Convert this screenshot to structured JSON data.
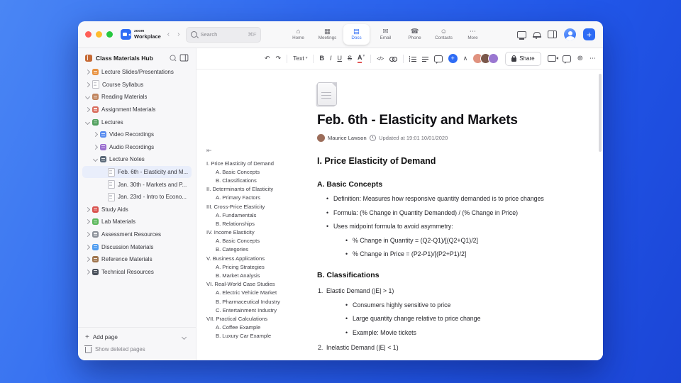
{
  "colors": {
    "accent": "#2e6cf5"
  },
  "icons": {
    "back": "‹",
    "forward": "›",
    "undo": "↶",
    "redo": "↷",
    "dropdown": "▾",
    "code": "</>",
    "collapse": "∧",
    "plus": "+",
    "more": "⋯",
    "globe": "⊕",
    "outline_collapse": "⇤"
  },
  "titlebar": {
    "logo_top": "zoom",
    "logo_bottom": "Workplace",
    "search": {
      "placeholder": "Search",
      "shortcut": "⌘F"
    },
    "tabs": [
      {
        "label": "Home",
        "glyph": "⌂"
      },
      {
        "label": "Meetings",
        "glyph": "▦"
      },
      {
        "label": "Docs",
        "glyph": "▤",
        "active": true
      },
      {
        "label": "Email",
        "glyph": "✉"
      },
      {
        "label": "Phone",
        "glyph": "☎"
      },
      {
        "label": "Contacts",
        "glyph": "☺"
      },
      {
        "label": "More",
        "glyph": "⋯"
      }
    ]
  },
  "sidebar": {
    "title": "Class Materials Hub",
    "add_page": "Add page",
    "show_deleted": "Show deleted pages",
    "items": [
      {
        "label": "Lecture Slides/Presentations",
        "indent": 0,
        "has_chevron": true,
        "icon": {
          "kind": "sq",
          "color": "#e8913f"
        }
      },
      {
        "label": "Course Syllabus",
        "indent": 0,
        "has_chevron": true,
        "icon": {
          "kind": "doc"
        }
      },
      {
        "label": "Reading Materials",
        "indent": 0,
        "has_chevron": true,
        "expanded": true,
        "icon": {
          "kind": "sq",
          "color": "#c0845e"
        }
      },
      {
        "label": "Assignment Materials",
        "indent": 0,
        "has_chevron": true,
        "icon": {
          "kind": "sq",
          "color": "#d96c5c"
        }
      },
      {
        "label": "Lectures",
        "indent": 0,
        "has_chevron": true,
        "expanded": true,
        "icon": {
          "kind": "sq",
          "color": "#51a05e"
        }
      },
      {
        "label": "Video Recordings",
        "indent": 1,
        "has_chevron": true,
        "icon": {
          "kind": "sq",
          "color": "#5b8def"
        }
      },
      {
        "label": "Audio Recordings",
        "indent": 1,
        "has_chevron": true,
        "icon": {
          "kind": "sq",
          "color": "#9b6fd0"
        }
      },
      {
        "label": "Lecture Notes",
        "indent": 1,
        "has_chevron": true,
        "expanded": true,
        "icon": {
          "kind": "sq",
          "color": "#5d6b7a"
        }
      },
      {
        "label": "Feb. 6th - Elasticity and M...",
        "indent": 2,
        "has_chevron": false,
        "selected": true,
        "icon": {
          "kind": "doc"
        }
      },
      {
        "label": "Jan. 30th - Markets and P...",
        "indent": 2,
        "has_chevron": false,
        "icon": {
          "kind": "doc"
        }
      },
      {
        "label": "Jan. 23rd - Intro to Econo...",
        "indent": 2,
        "has_chevron": false,
        "icon": {
          "kind": "doc"
        }
      },
      {
        "label": "Study Aids",
        "indent": 0,
        "has_chevron": true,
        "icon": {
          "kind": "sq",
          "color": "#d9534f"
        }
      },
      {
        "label": "Lab Materials",
        "indent": 0,
        "has_chevron": true,
        "icon": {
          "kind": "sq",
          "color": "#5cb85c"
        }
      },
      {
        "label": "Assessment Resources",
        "indent": 0,
        "has_chevron": true,
        "icon": {
          "kind": "sq",
          "color": "#8a8f98"
        }
      },
      {
        "label": "Discussion Materials",
        "indent": 0,
        "has_chevron": true,
        "icon": {
          "kind": "sq",
          "color": "#4f9cf0"
        }
      },
      {
        "label": "Reference Materials",
        "indent": 0,
        "has_chevron": true,
        "icon": {
          "kind": "sq",
          "color": "#a0764f"
        }
      },
      {
        "label": "Technical Resources",
        "indent": 0,
        "has_chevron": true,
        "icon": {
          "kind": "sq",
          "color": "#49505a"
        }
      }
    ]
  },
  "toolbar": {
    "text_label": "Text",
    "bold": "B",
    "italic": "I",
    "underline": "U",
    "strike": "S",
    "color": "A",
    "share": "Share",
    "collaborators": [
      {
        "color": "#e0927f"
      },
      {
        "color": "#7a574a"
      },
      {
        "color": "#9a77d1"
      }
    ]
  },
  "document": {
    "title": "Feb. 6th - Elasticity and Markets",
    "author": "Maurice Lawson",
    "updated": "Updated at 19:01 10/01/2020",
    "outline": [
      {
        "text": "I. Price Elasticity of Demand",
        "level": 1
      },
      {
        "text": "A. Basic Concepts",
        "level": 2
      },
      {
        "text": "B. Classifications",
        "level": 2
      },
      {
        "text": "II. Determinants of Elasticity",
        "level": 1
      },
      {
        "text": "A. Primary Factors",
        "level": 2
      },
      {
        "text": "III. Cross-Price Elasticity",
        "level": 1
      },
      {
        "text": "A. Fundamentals",
        "level": 2
      },
      {
        "text": "B. Relationships",
        "level": 2
      },
      {
        "text": "IV. Income Elasticity",
        "level": 1
      },
      {
        "text": "A. Basic Concepts",
        "level": 2
      },
      {
        "text": "B. Categories",
        "level": 2
      },
      {
        "text": "V. Business Applications",
        "level": 1
      },
      {
        "text": "A. Pricing Strategies",
        "level": 2
      },
      {
        "text": "B. Market Analysis",
        "level": 2
      },
      {
        "text": "VI. Real-World Case Studies",
        "level": 1
      },
      {
        "text": "A. Electric Vehicle Market",
        "level": 2
      },
      {
        "text": "B. Pharmaceutical Industry",
        "level": 2
      },
      {
        "text": "C. Entertainment Industry",
        "level": 2
      },
      {
        "text": "VII. Practical Calculations",
        "level": 1
      },
      {
        "text": "A. Coffee Example",
        "level": 2
      },
      {
        "text": "B. Luxury Car Example",
        "level": 2
      }
    ],
    "blocks": [
      {
        "type": "h2",
        "text": "I. Price Elasticity of Demand"
      },
      {
        "type": "h3",
        "text": "A. Basic Concepts"
      },
      {
        "type": "li1",
        "marker": "•",
        "text": "Definition: Measures how responsive quantity demanded is to price changes"
      },
      {
        "type": "li1",
        "marker": "•",
        "text": "Formula: (% Change in Quantity Demanded) / (% Change in Price)"
      },
      {
        "type": "li1",
        "marker": "•",
        "text": "Uses midpoint formula to avoid asymmetry:"
      },
      {
        "type": "li2",
        "marker": "•",
        "text": "% Change in Quantity = (Q2-Q1)/[(Q2+Q1)/2]"
      },
      {
        "type": "li2",
        "marker": "•",
        "text": "% Change in Price = (P2-P1)/[(P2+P1)/2]"
      },
      {
        "type": "h3",
        "text": "B. Classifications"
      },
      {
        "type": "num",
        "marker": "1.",
        "text": "Elastic Demand (|E| > 1)"
      },
      {
        "type": "li2",
        "marker": "•",
        "text": "Consumers highly sensitive to price"
      },
      {
        "type": "li2",
        "marker": "•",
        "text": "Large quantity change relative to price change"
      },
      {
        "type": "li2",
        "marker": "•",
        "text": "Example: Movie tickets"
      },
      {
        "type": "num",
        "marker": "2.",
        "text": "Inelastic Demand (|E| < 1)"
      }
    ]
  }
}
